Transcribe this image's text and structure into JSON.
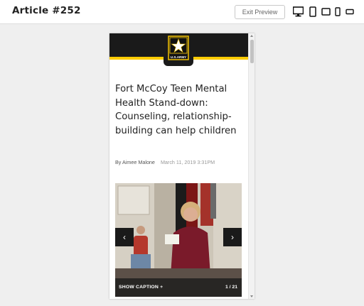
{
  "header": {
    "title": "Article #252",
    "exit_label": "Exit Preview",
    "devices": [
      "desktop-icon",
      "tablet-portrait-icon",
      "tablet-landscape-icon",
      "phone-portrait-icon",
      "phone-landscape-icon"
    ]
  },
  "article": {
    "brand_colors": {
      "black": "#1a1a1a",
      "gold": "#ffcc01"
    },
    "logo_text": "U.S.ARMY",
    "headline": "Fort McCoy Teen Mental Health Stand-down: Counseling, relationship-building can help children",
    "author": "By Aimee Malone",
    "date": "March 11, 2019 3:31PM",
    "slideshow": {
      "prev": "‹",
      "next": "›",
      "caption_toggle": "SHOW CAPTION +",
      "counter": "1 / 21"
    }
  }
}
